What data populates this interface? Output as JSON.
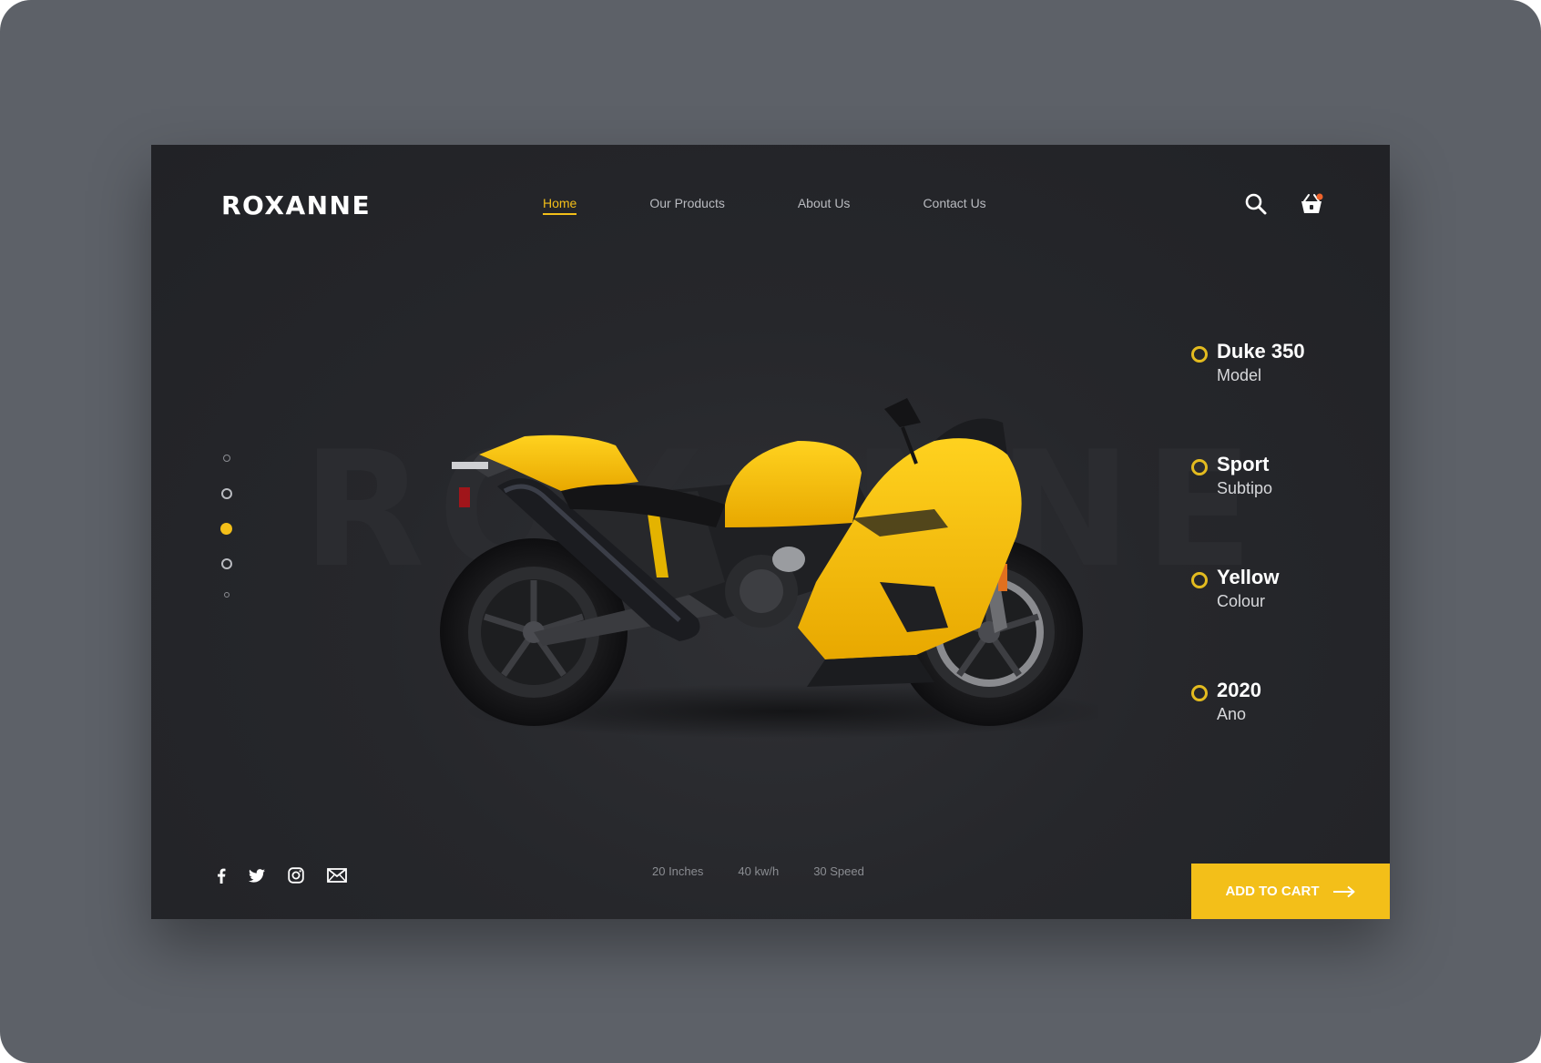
{
  "brand": {
    "logo": "ROXANNE",
    "watermark": "ROXANNE"
  },
  "nav": {
    "items": [
      {
        "label": "Home",
        "active": true
      },
      {
        "label": "Our Products",
        "active": false
      },
      {
        "label": "About Us",
        "active": false
      },
      {
        "label": "Contact Us",
        "active": false
      }
    ]
  },
  "header_icons": [
    "search-icon",
    "cart-icon"
  ],
  "cart": {
    "has_notification": true
  },
  "slider": {
    "total": 5,
    "active_index": 3
  },
  "specs": [
    {
      "value": "Duke 350",
      "label": "Model"
    },
    {
      "value": "Sport",
      "label": "Subtipo"
    },
    {
      "value": "Yellow",
      "label": "Colour"
    },
    {
      "value": "2020",
      "label": "Ano"
    }
  ],
  "social": [
    "facebook-icon",
    "twitter-icon",
    "instagram-icon",
    "mail-icon"
  ],
  "features": [
    "20 Inches",
    "40 kw/h",
    "30 Speed"
  ],
  "cta": {
    "label": "ADD TO CART"
  },
  "colors": {
    "accent": "#f3bf19",
    "background": "#26272b",
    "backdrop": "#5d6168",
    "bike_body": "#f5b90f",
    "notification": "#f0632b"
  }
}
